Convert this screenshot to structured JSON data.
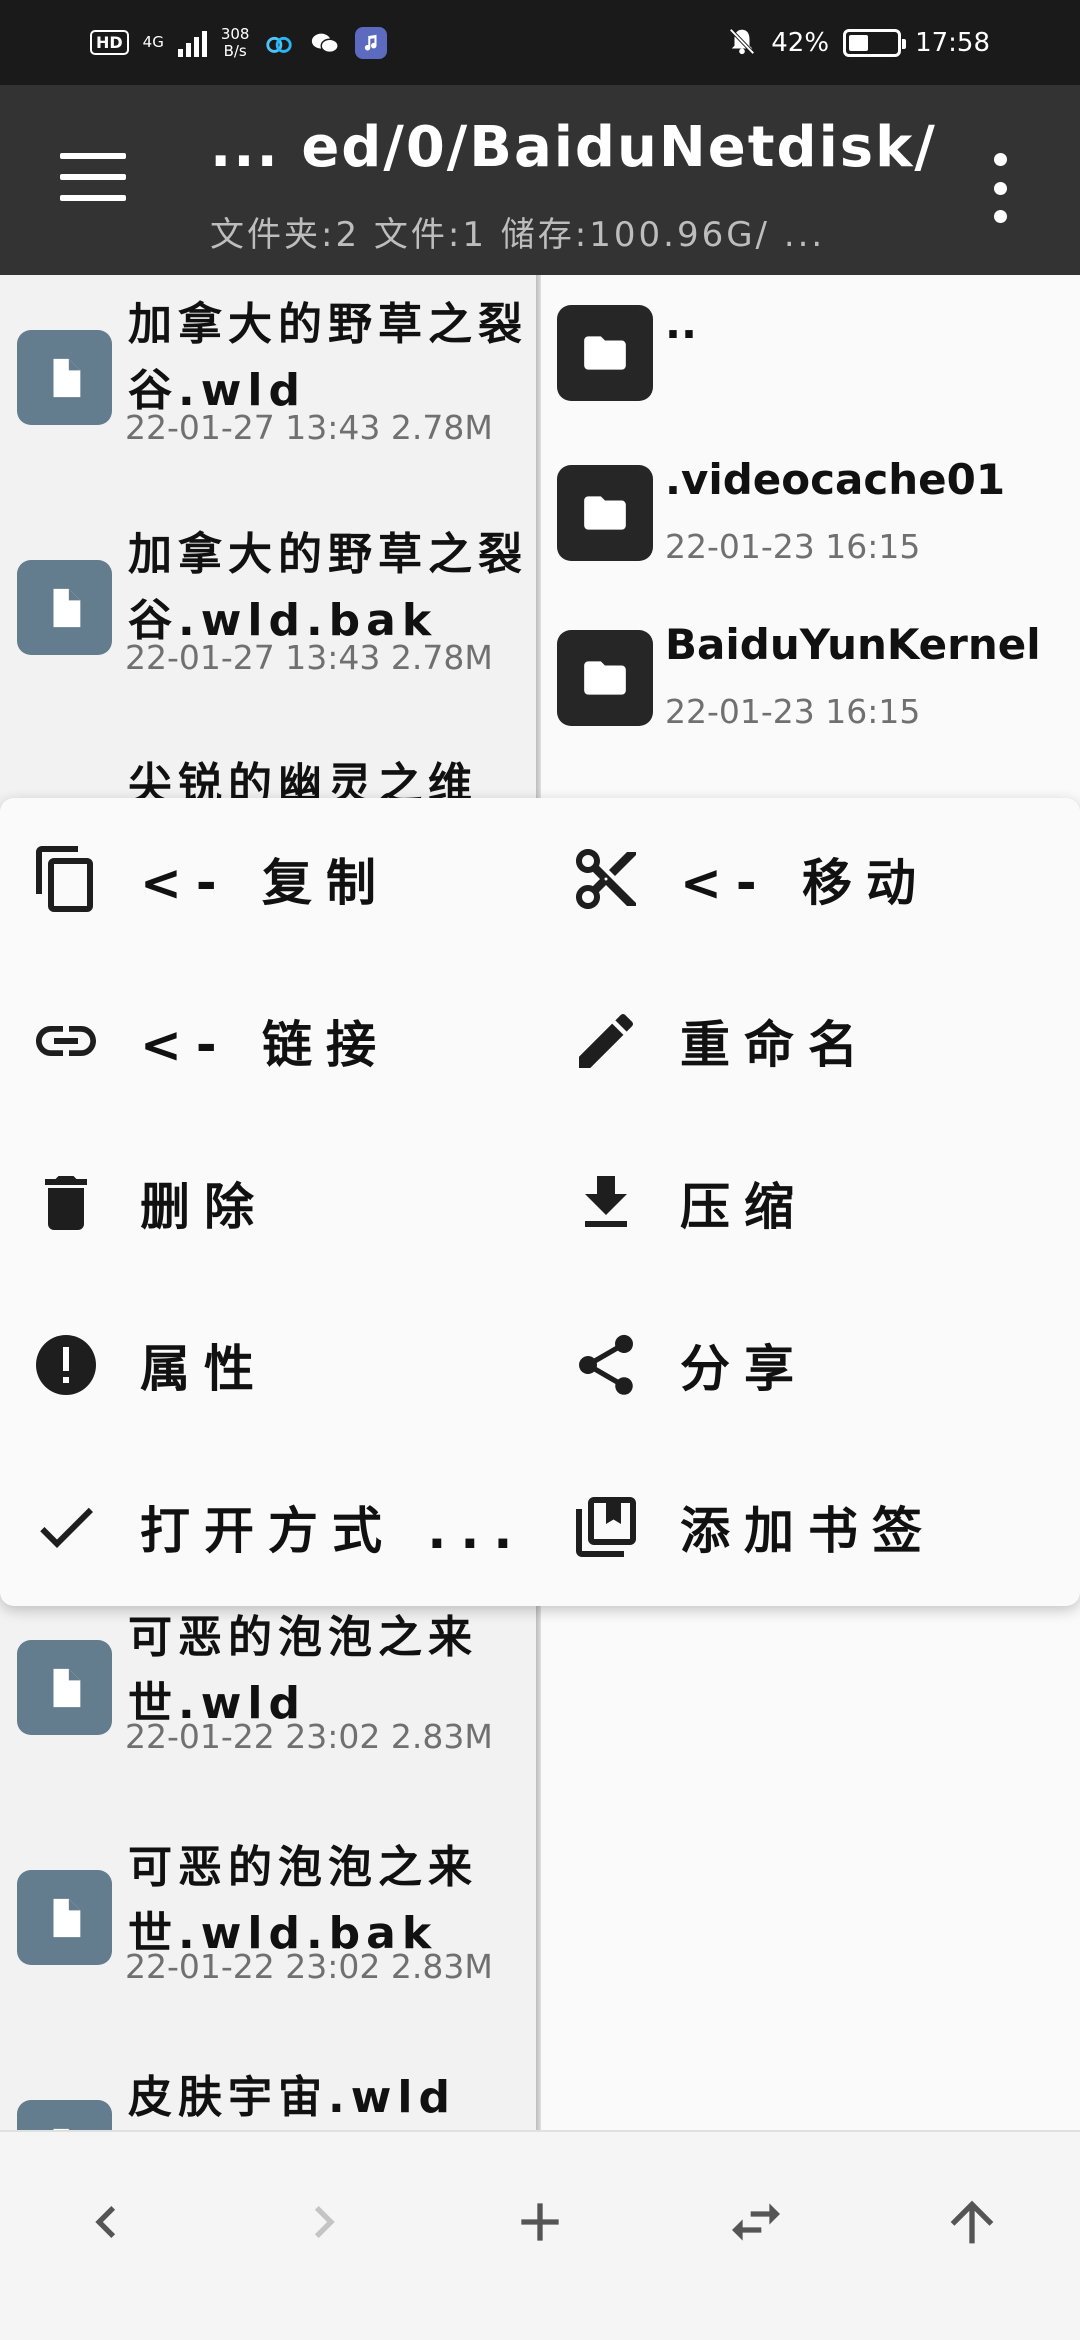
{
  "status_bar": {
    "network_hd": "HD",
    "network_gen": "4G",
    "speed_value": "308",
    "speed_unit": "B/s",
    "battery_percent": "42%",
    "battery_level": 0.42,
    "time": "17:58"
  },
  "app_bar": {
    "path": "... ed/0/BaiduNetdisk/",
    "summary": "文件夹:2 文件:1 储存:100.96G/ ..."
  },
  "left_pane": {
    "items": [
      {
        "name": "加拿大的野草之裂谷.wld",
        "meta": "22-01-27 13:43 2.78M"
      },
      {
        "name": "加拿大的野草之裂谷.wld.bak",
        "meta": "22-01-27 13:43 2.78M"
      },
      {
        "name": "尖锐的幽灵之维",
        "meta": ""
      },
      {
        "name": "可恶的泡泡之来世.wld",
        "meta": "22-01-22 23:02 2.83M"
      },
      {
        "name": "可恶的泡泡之来世.wld.bak",
        "meta": "22-01-22 23:02 2.83M"
      },
      {
        "name": "皮肤宇宙.wld",
        "meta": ""
      }
    ]
  },
  "right_pane": {
    "items": [
      {
        "name": "..",
        "meta": ""
      },
      {
        "name": ".videocache01",
        "meta": "22-01-23 16:15"
      },
      {
        "name": "BaiduYunKernel",
        "meta": "22-01-23 16:15"
      }
    ]
  },
  "context_menu": {
    "items": [
      {
        "label": "<- 复制",
        "icon": "copy-icon"
      },
      {
        "label": "<- 移动",
        "icon": "cut-icon"
      },
      {
        "label": "<- 链接",
        "icon": "link-icon"
      },
      {
        "label": "重命名",
        "icon": "pencil-icon"
      },
      {
        "label": "删除",
        "icon": "trash-icon"
      },
      {
        "label": "压缩",
        "icon": "download-icon"
      },
      {
        "label": "属性",
        "icon": "info-icon"
      },
      {
        "label": "分享",
        "icon": "share-icon"
      },
      {
        "label": "打开方式 ...",
        "icon": "check-icon"
      },
      {
        "label": "添加书签",
        "icon": "bookmark-icon"
      }
    ]
  },
  "bottom_bar": {
    "buttons": [
      "back-icon",
      "forward-icon",
      "add-icon",
      "swap-icon",
      "up-icon"
    ]
  }
}
